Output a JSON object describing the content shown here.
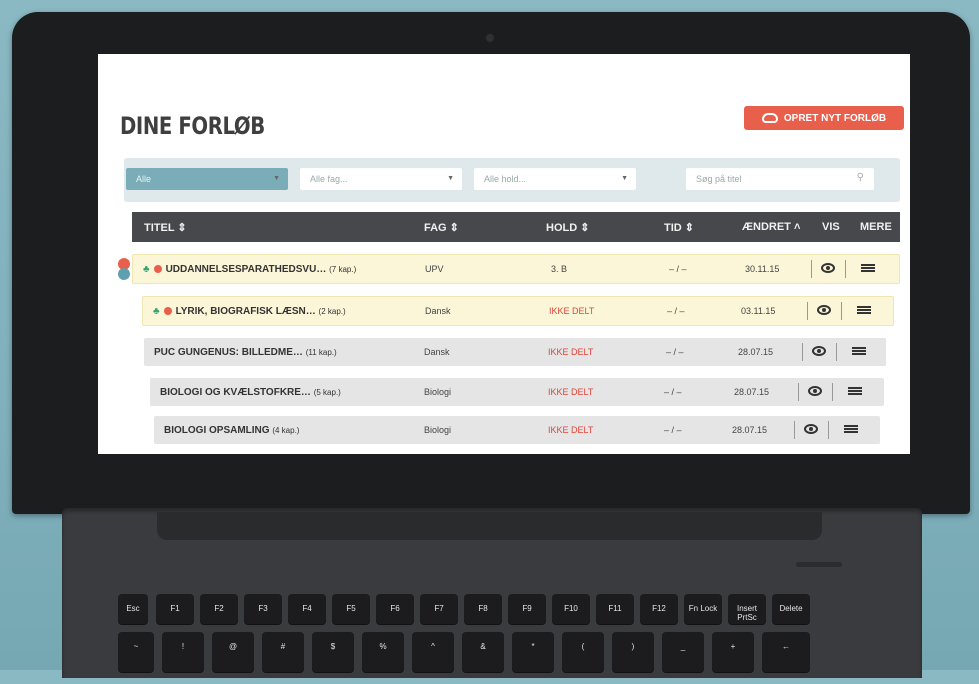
{
  "page": {
    "title": "DINE FORLØB",
    "create_button": "OPRET NYT FORLØB"
  },
  "filters": {
    "scope": "Alle",
    "subject_placeholder": "Alle fag...",
    "team_placeholder": "Alle hold...",
    "search_placeholder": "Søg på titel"
  },
  "table": {
    "headers": {
      "title": "TITEL ⇕",
      "subject": "FAG ⇕",
      "team": "HOLD ⇕",
      "time": "TID ⇕",
      "changed": "ÆNDRET ˄",
      "view": "VIS",
      "more": "MERE"
    },
    "rows": [
      {
        "title": "UDDANNELSESPARATHEDSVU…",
        "chapters": "(7 kap.)",
        "subject": "UPV",
        "team": "3. B",
        "time": "– / –",
        "changed": "30.11.15"
      },
      {
        "title": "LYRIK, BIOGRAFISK LÆSN…",
        "chapters": "(2 kap.)",
        "subject": "Dansk",
        "team": "IKKE DELT",
        "time": "– / –",
        "changed": "03.11.15"
      },
      {
        "title": "PUC GUNGENUS: BILLEDME…",
        "chapters": "(11 kap.)",
        "subject": "Dansk",
        "team": "IKKE DELT",
        "time": "– / –",
        "changed": "28.07.15"
      },
      {
        "title": "BIOLOGI OG KVÆLSTOFKRE…",
        "chapters": "(5 kap.)",
        "subject": "Biologi",
        "team": "IKKE DELT",
        "time": "– / –",
        "changed": "28.07.15"
      },
      {
        "title": "BIOLOGI OPSAMLING",
        "chapters": "(4 kap.)",
        "subject": "Biologi",
        "team": "IKKE DELT",
        "time": "– / –",
        "changed": "28.07.15"
      }
    ]
  },
  "keyboard": {
    "fn_row": [
      "Esc",
      "F1",
      "F2",
      "F3",
      "F4",
      "F5",
      "F6",
      "F7",
      "F8",
      "F9",
      "F10",
      "F11",
      "F12",
      "Fn Lock",
      "Insert PrtSc",
      "Delete"
    ],
    "num_row": [
      "~",
      "!",
      "@",
      "#",
      "$",
      "%",
      "^",
      "&",
      "*",
      "(",
      ")",
      "_",
      "+",
      "←"
    ]
  }
}
